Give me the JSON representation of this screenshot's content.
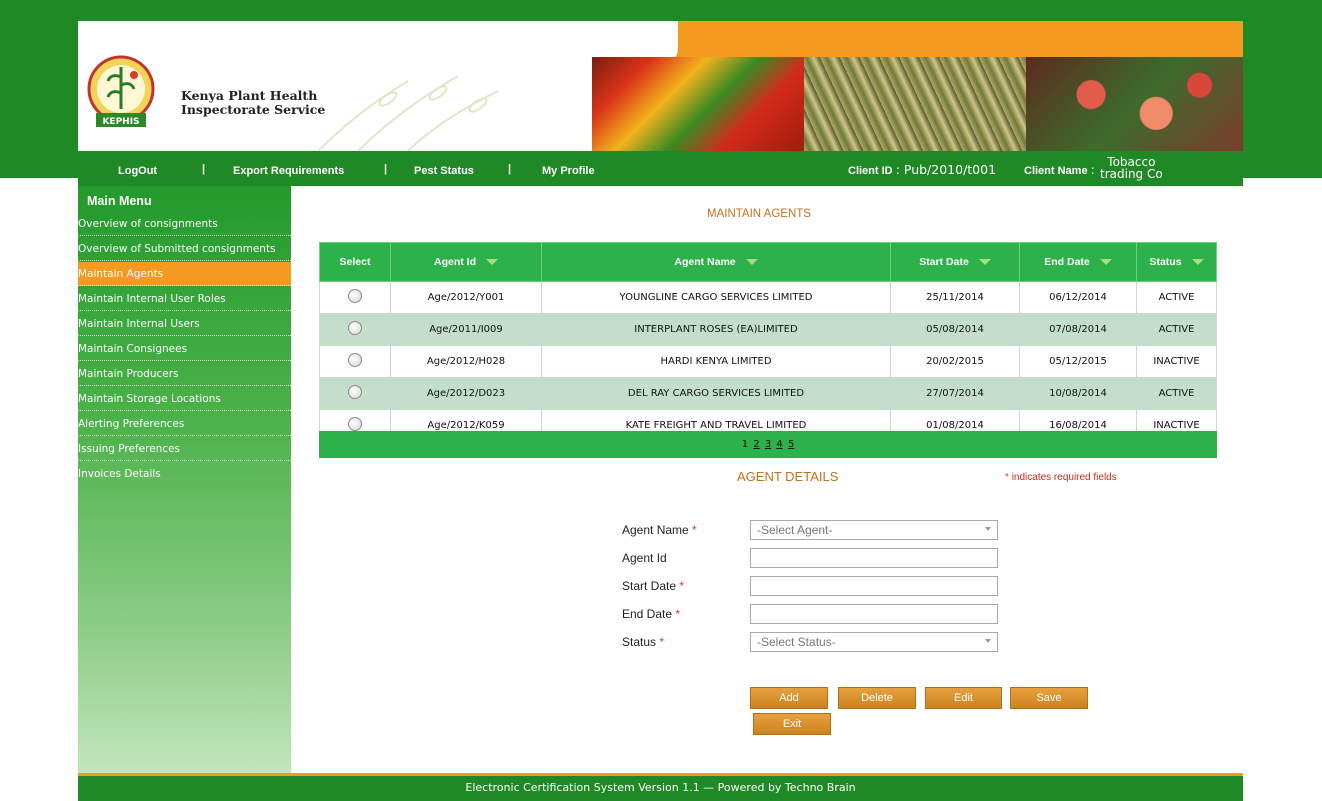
{
  "header": {
    "org_line1": "Kenya Plant Health",
    "org_line2": "Inspectorate Service",
    "logo_text": "KEPHIS"
  },
  "nav": {
    "logout": "LogOut",
    "export_requirements": "Export Requirements",
    "pest_status": "Pest Status",
    "my_profile": "My Profile",
    "separator": "|",
    "client_id_label": "Client ID",
    "client_id_value": ": Pub/2010/t001",
    "client_name_label": "Client Name",
    "client_name_colon": ":",
    "client_name_line1": "Tobacco",
    "client_name_line2": "trading Co"
  },
  "sidebar": {
    "title": "Main Menu",
    "items": [
      {
        "label": "Overview of consignments"
      },
      {
        "label": "Overview of Submitted consignments"
      },
      {
        "label": "Maintain Agents"
      },
      {
        "label": "Maintain Internal User Roles"
      },
      {
        "label": "Maintain Internal Users"
      },
      {
        "label": "Maintain Consignees"
      },
      {
        "label": "Maintain Producers"
      },
      {
        "label": "Maintain Storage Locations"
      },
      {
        "label": "Alerting Preferences"
      },
      {
        "label": "Issuing Preferences"
      },
      {
        "label": "Invoices Details"
      }
    ],
    "active_index": 2
  },
  "main": {
    "title": "MAINTAIN AGENTS",
    "table": {
      "headers": [
        "Select",
        "Agent Id",
        "Agent Name",
        "Start Date",
        "End Date",
        "Status"
      ],
      "rows": [
        {
          "agent_id": "Age/2012/Y001",
          "agent_name": "YOUNGLINE CARGO SERVICES LIMITED",
          "start": "25/11/2014",
          "end": "06/12/2014",
          "status": "ACTIVE"
        },
        {
          "agent_id": "Age/2011/I009",
          "agent_name": "INTERPLANT ROSES (EA)LIMITED",
          "start": "05/08/2014",
          "end": "07/08/2014",
          "status": "ACTIVE"
        },
        {
          "agent_id": "Age/2012/H028",
          "agent_name": "HARDI KENYA LIMITED",
          "start": "20/02/2015",
          "end": "05/12/2015",
          "status": "INACTIVE"
        },
        {
          "agent_id": "Age/2012/D023",
          "agent_name": "DEL RAY CARGO SERVICES LIMITED",
          "start": "27/07/2014",
          "end": "10/08/2014",
          "status": "ACTIVE"
        },
        {
          "agent_id": "Age/2012/K059",
          "agent_name": "KATE FREIGHT AND TRAVEL LIMITED",
          "start": "01/08/2014",
          "end": "16/08/2014",
          "status": "INACTIVE"
        }
      ]
    },
    "pager": {
      "pages": [
        "1",
        "2",
        "3",
        "4",
        "5"
      ],
      "current": "1"
    }
  },
  "details": {
    "title": "AGENT DETAILS",
    "required_star": "*",
    "required_note": "indicates required fields",
    "fields": {
      "agent_name_label": "Agent Name",
      "agent_name_value": "-Select Agent-",
      "agent_id_label": "Agent Id",
      "agent_id_value": "",
      "start_date_label": "Start Date",
      "start_date_value": "",
      "end_date_label": "End Date",
      "end_date_value": "",
      "status_label": "Status",
      "status_value": "-Select Status-"
    },
    "buttons": {
      "add": "Add",
      "delete": "Delete",
      "edit": "Edit",
      "save": "Save",
      "exit": "Exit"
    }
  },
  "footer": {
    "text": "Electronic Certification System Version 1.1 — Powered by Techno Brain"
  },
  "colors": {
    "brand_green": "#1f8a25",
    "accent_orange": "#f39a1f",
    "table_header": "#2db24b",
    "row_alt": "#c3dfcc"
  }
}
